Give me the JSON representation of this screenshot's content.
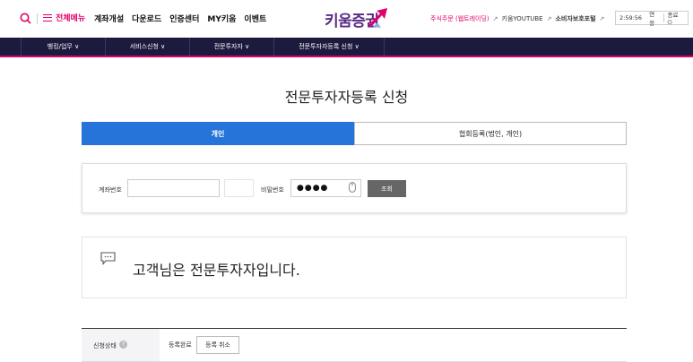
{
  "header": {
    "all_menu_label": "전체메뉴",
    "nav": [
      "계좌개설",
      "다운로드",
      "인증센터",
      "MY키움",
      "이벤트"
    ],
    "logo_text": "키움증권",
    "util_links": {
      "stock_order": "주식주문 (웹트레이딩)",
      "youtube": "키움YOUTUBE",
      "consumer": "소비자보호포털"
    },
    "timer": "2:59:56",
    "extend_label": "연장",
    "logout_label": "종료"
  },
  "subnav": [
    "뱅킹/업무",
    "서비스신청",
    "전문투자자",
    "전문투자자등록 신청"
  ],
  "page_title": "전문투자자등록 신청",
  "tabs": {
    "individual": "개인",
    "association": "협회등록(법인, 개인)"
  },
  "query": {
    "account_label": "계좌번호",
    "account_value": "",
    "password_label": "비밀번호",
    "password_mask": "●●●●",
    "inquiry_button": "조회"
  },
  "message": "고객님은 전문투자자입니다.",
  "status": {
    "label": "신청상태",
    "help": "?",
    "value": "등록완료",
    "cancel_button": "등록 취소"
  },
  "colors": {
    "brand_pink": "#e0006b",
    "brand_purple": "#5b2a86",
    "nav_dark": "#1c1a3d",
    "tab_blue": "#2673d9"
  }
}
